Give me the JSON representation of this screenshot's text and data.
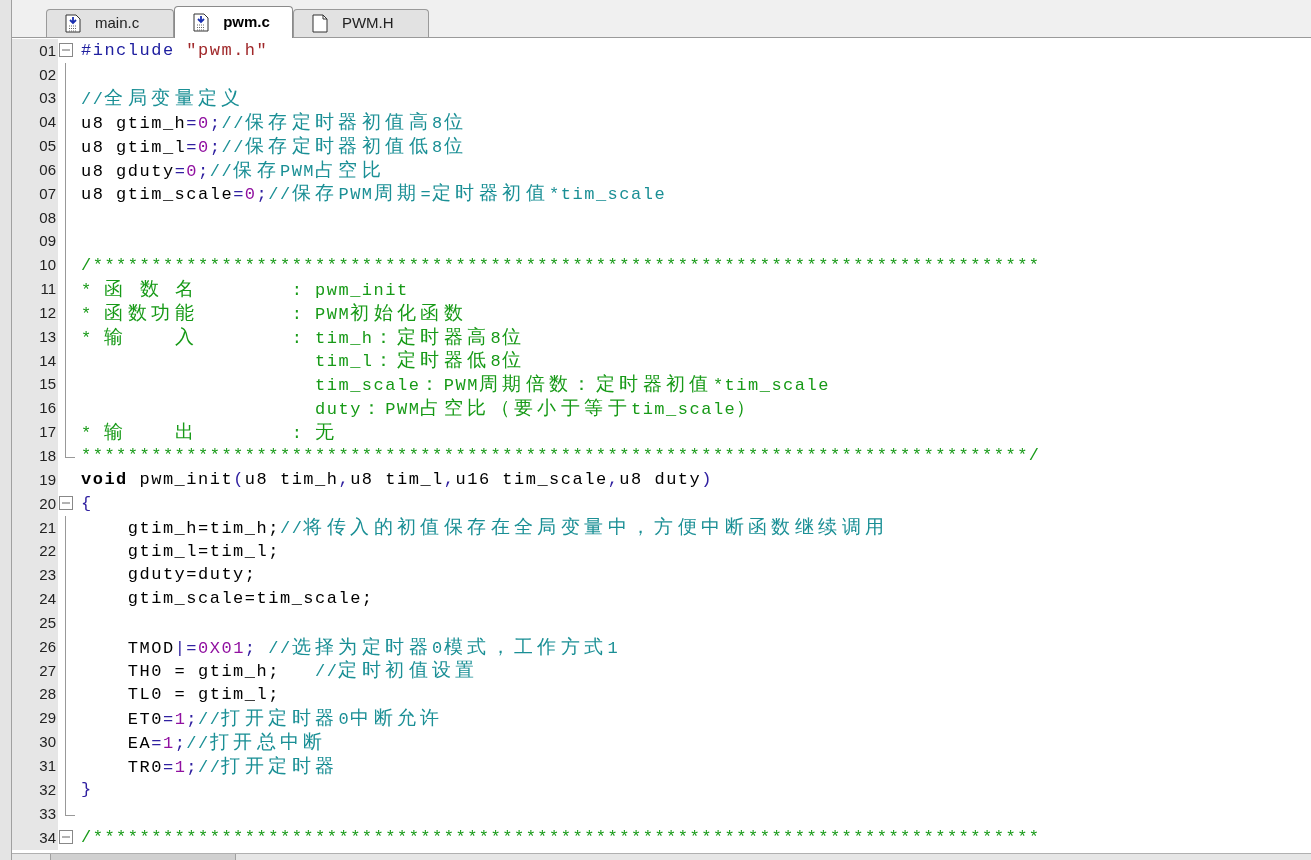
{
  "tabs": [
    {
      "label": "main.c",
      "selected": false,
      "kind": "source"
    },
    {
      "label": "pwm.c",
      "selected": true,
      "kind": "source"
    },
    {
      "label": "PWM.H",
      "selected": false,
      "kind": "header"
    }
  ],
  "lines": [
    {
      "number": "01",
      "kind": "fold-start",
      "tokens": [
        {
          "kind": "preproc",
          "text": "#include "
        },
        {
          "kind": "string",
          "text": "\"pwm.h\""
        }
      ]
    },
    {
      "number": "02",
      "kind": "fold-body"
    },
    {
      "number": "03",
      "kind": "fold-body",
      "tokens": [
        {
          "kind": "comment",
          "text": "//全局变量定义"
        }
      ]
    },
    {
      "number": "04",
      "kind": "fold-body",
      "tokens": [
        {
          "kind": "plain",
          "text": "u8 gtim_h"
        },
        {
          "kind": "punct",
          "text": "="
        },
        {
          "kind": "number",
          "text": "0"
        },
        {
          "kind": "punct",
          "text": ";"
        },
        {
          "kind": "comment",
          "text": "//保存定时器初值高8位"
        }
      ]
    },
    {
      "number": "05",
      "kind": "fold-body",
      "tokens": [
        {
          "kind": "plain",
          "text": "u8 gtim_l"
        },
        {
          "kind": "punct",
          "text": "="
        },
        {
          "kind": "number",
          "text": "0"
        },
        {
          "kind": "punct",
          "text": ";"
        },
        {
          "kind": "comment",
          "text": "//保存定时器初值低8位"
        }
      ]
    },
    {
      "number": "06",
      "kind": "fold-body",
      "tokens": [
        {
          "kind": "plain",
          "text": "u8 gduty"
        },
        {
          "kind": "punct",
          "text": "="
        },
        {
          "kind": "number",
          "text": "0"
        },
        {
          "kind": "punct",
          "text": ";"
        },
        {
          "kind": "comment",
          "text": "//保存PWM占空比"
        }
      ]
    },
    {
      "number": "07",
      "kind": "fold-body",
      "tokens": [
        {
          "kind": "plain",
          "text": "u8 gtim_scale"
        },
        {
          "kind": "punct",
          "text": "="
        },
        {
          "kind": "number",
          "text": "0"
        },
        {
          "kind": "punct",
          "text": ";"
        },
        {
          "kind": "comment",
          "text": "//保存PWM周期=定时器初值*tim_scale"
        }
      ]
    },
    {
      "number": "08",
      "kind": "fold-body"
    },
    {
      "number": "09",
      "kind": "fold-body"
    },
    {
      "number": "10",
      "kind": "fold-body",
      "tokens": [
        {
          "kind": "doc",
          "text": "/*********************************************************************************"
        }
      ]
    },
    {
      "number": "11",
      "kind": "fold-body",
      "tokens": [
        {
          "kind": "doc",
          "text": "* 函 数 名        : pwm_init"
        }
      ]
    },
    {
      "number": "12",
      "kind": "fold-body",
      "tokens": [
        {
          "kind": "doc",
          "text": "* 函数功能        : PWM初始化函数"
        }
      ]
    },
    {
      "number": "13",
      "kind": "fold-body",
      "tokens": [
        {
          "kind": "doc",
          "text": "* 输    入        : tim_h：定时器高8位"
        }
      ]
    },
    {
      "number": "14",
      "kind": "fold-body",
      "tokens": [
        {
          "kind": "doc",
          "text": "                    tim_l：定时器低8位"
        }
      ]
    },
    {
      "number": "15",
      "kind": "fold-body",
      "tokens": [
        {
          "kind": "doc",
          "text": "                    tim_scale：PWM周期倍数：定时器初值*tim_scale"
        }
      ]
    },
    {
      "number": "16",
      "kind": "fold-body",
      "tokens": [
        {
          "kind": "doc",
          "text": "                    duty：PWM占空比（要小于等于tim_scale）"
        }
      ]
    },
    {
      "number": "17",
      "kind": "fold-body",
      "tokens": [
        {
          "kind": "doc",
          "text": "* 输    出        : 无"
        }
      ]
    },
    {
      "number": "18",
      "kind": "fold-end",
      "tokens": [
        {
          "kind": "doc",
          "text": "*********************************************************************************/"
        }
      ]
    },
    {
      "number": "19",
      "kind": "plain",
      "tokens": [
        {
          "kind": "keyword",
          "text": "void"
        },
        {
          "kind": "plain",
          "text": " pwm_init"
        },
        {
          "kind": "punct",
          "text": "("
        },
        {
          "kind": "plain",
          "text": "u8 tim_h"
        },
        {
          "kind": "punct",
          "text": ","
        },
        {
          "kind": "plain",
          "text": "u8 tim_l"
        },
        {
          "kind": "punct",
          "text": ","
        },
        {
          "kind": "plain",
          "text": "u16 tim_scale"
        },
        {
          "kind": "punct",
          "text": ","
        },
        {
          "kind": "plain",
          "text": "u8 duty"
        },
        {
          "kind": "punct",
          "text": ")"
        }
      ]
    },
    {
      "number": "20",
      "kind": "fold-start",
      "tokens": [
        {
          "kind": "punct",
          "text": "{"
        }
      ]
    },
    {
      "number": "21",
      "kind": "fold-body",
      "tokens": [
        {
          "kind": "plain",
          "text": "    gtim_h=tim_h;"
        },
        {
          "kind": "comment",
          "text": "//将传入的初值保存在全局变量中，方便中断函数继续调用"
        }
      ]
    },
    {
      "number": "22",
      "kind": "fold-body",
      "tokens": [
        {
          "kind": "plain",
          "text": "    gtim_l=tim_l;"
        }
      ]
    },
    {
      "number": "23",
      "kind": "fold-body",
      "tokens": [
        {
          "kind": "plain",
          "text": "    gduty=duty;"
        }
      ]
    },
    {
      "number": "24",
      "kind": "fold-body",
      "tokens": [
        {
          "kind": "plain",
          "text": "    gtim_scale=tim_scale;"
        }
      ]
    },
    {
      "number": "25",
      "kind": "fold-body"
    },
    {
      "number": "26",
      "kind": "fold-body",
      "tokens": [
        {
          "kind": "plain",
          "text": "    TMOD"
        },
        {
          "kind": "punct",
          "text": "|="
        },
        {
          "kind": "number",
          "text": "0X01"
        },
        {
          "kind": "punct",
          "text": "; "
        },
        {
          "kind": "comment",
          "text": "//选择为定时器0模式，工作方式1"
        }
      ]
    },
    {
      "number": "27",
      "kind": "fold-body",
      "tokens": [
        {
          "kind": "plain",
          "text": "    TH0 = gtim_h;   "
        },
        {
          "kind": "comment",
          "text": "//定时初值设置"
        }
      ]
    },
    {
      "number": "28",
      "kind": "fold-body",
      "tokens": [
        {
          "kind": "plain",
          "text": "    TL0 = gtim_l;"
        }
      ]
    },
    {
      "number": "29",
      "kind": "fold-body",
      "tokens": [
        {
          "kind": "plain",
          "text": "    ET0"
        },
        {
          "kind": "punct",
          "text": "="
        },
        {
          "kind": "number",
          "text": "1"
        },
        {
          "kind": "punct",
          "text": ";"
        },
        {
          "kind": "comment",
          "text": "//打开定时器0中断允许"
        }
      ]
    },
    {
      "number": "30",
      "kind": "fold-body",
      "tokens": [
        {
          "kind": "plain",
          "text": "    EA"
        },
        {
          "kind": "punct",
          "text": "="
        },
        {
          "kind": "number",
          "text": "1"
        },
        {
          "kind": "punct",
          "text": ";"
        },
        {
          "kind": "comment",
          "text": "//打开总中断"
        }
      ]
    },
    {
      "number": "31",
      "kind": "fold-body",
      "tokens": [
        {
          "kind": "plain",
          "text": "    TR0"
        },
        {
          "kind": "punct",
          "text": "="
        },
        {
          "kind": "number",
          "text": "1"
        },
        {
          "kind": "punct",
          "text": ";"
        },
        {
          "kind": "comment",
          "text": "//打开定时器"
        }
      ]
    },
    {
      "number": "32",
      "kind": "fold-body",
      "tokens": [
        {
          "kind": "punct",
          "text": "}"
        }
      ]
    },
    {
      "number": "33",
      "kind": "fold-end"
    },
    {
      "number": "34",
      "kind": "fold-start",
      "tokens": [
        {
          "kind": "doc",
          "text": "/*********************************************************************************"
        }
      ]
    }
  ]
}
